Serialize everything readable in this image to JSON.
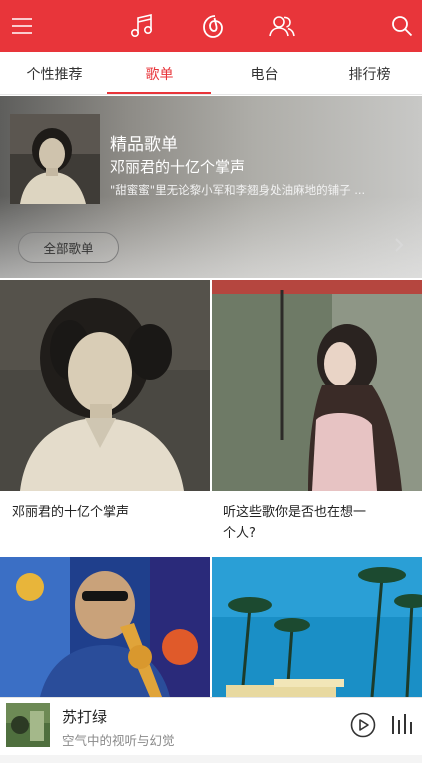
{
  "header": {
    "icons": [
      "menu-icon",
      "music-note-icon",
      "netease-music-icon",
      "friends-icon",
      "search-icon"
    ],
    "colors": {
      "accent": "#e8353a",
      "text": "#333333",
      "muted": "#8a8a8a"
    }
  },
  "tabs": [
    {
      "label": "个性推荐",
      "active": false
    },
    {
      "label": "歌单",
      "active": true
    },
    {
      "label": "电台",
      "active": false
    },
    {
      "label": "排行榜",
      "active": false
    }
  ],
  "banner": {
    "title": "精品歌单",
    "subtitle": "邓丽君的十亿个掌声",
    "description": "\"甜蜜蜜\"里无论黎小军和李翘身处油麻地的铺子 ...",
    "all_button": "全部歌单"
  },
  "playlists": [
    {
      "title": "邓丽君的十亿个掌声"
    },
    {
      "title_line1": "听这些歌你是否也在想一",
      "title_line2": "个人?"
    },
    {
      "title": ""
    },
    {
      "title": ""
    }
  ],
  "player": {
    "song": "苏打绿",
    "artist": "空气中的视听与幻觉"
  }
}
